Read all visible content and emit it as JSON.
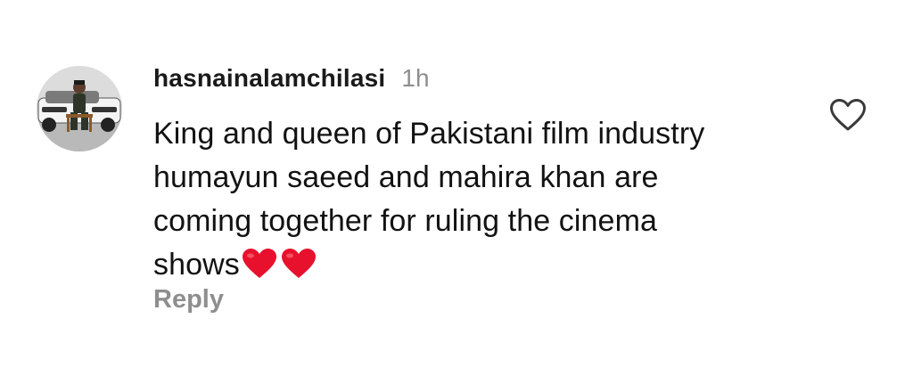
{
  "comment": {
    "avatar_icon": "user-avatar",
    "username": "hasnainalamchilasi",
    "timestamp": "1h",
    "text_lines": [
      "King and queen of Pakistani film industry",
      "humayun saeed and mahira khan are",
      "coming together for ruling the cinema",
      "shows"
    ],
    "trailing_emojis": [
      "red-heart",
      "red-heart"
    ],
    "reply_label": "Reply",
    "like_icon": "heart-outline-icon"
  },
  "colors": {
    "text": "#121212",
    "muted": "#8e8e8e",
    "heart": "#e8112d"
  }
}
